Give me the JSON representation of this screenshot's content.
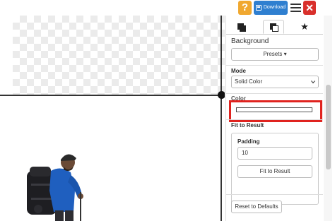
{
  "toolbar": {
    "help_label": "?",
    "download_label": "Download",
    "close_label": "✕"
  },
  "panel": {
    "background_title": "Background",
    "presets_label": "Presets ▾",
    "mode_label": "Mode",
    "mode_value": "Solid Color",
    "color_label": "Color",
    "fit_title": "Fit to Result",
    "padding_label": "Padding",
    "padding_value": "10",
    "fit_button": "Fit to Result",
    "reset_button": "Reset to Defaults"
  },
  "icons": {
    "tab1": "front-layer-icon",
    "tab2": "back-layer-icon",
    "tab3": "star-icon"
  },
  "colors": {
    "help_bg": "#f0a830",
    "download_bg": "#2f7fd0",
    "close_bg": "#d9302c",
    "highlight": "#e0231f"
  }
}
